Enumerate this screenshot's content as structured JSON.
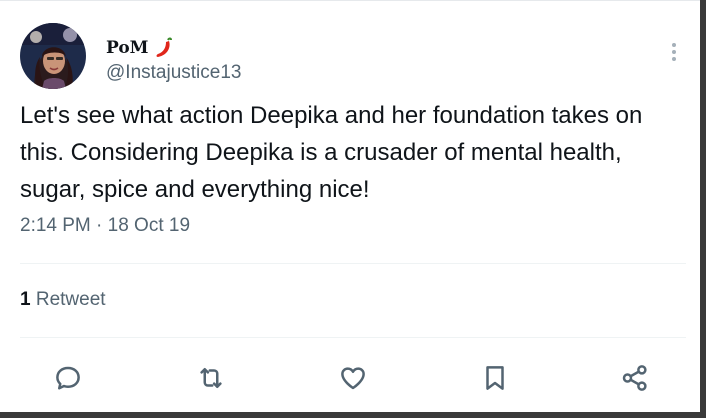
{
  "tweet": {
    "display_name": "PoM",
    "name_emoji": "chili-pepper",
    "handle": "@Instajustice13",
    "text": "Let's see what action Deepika and her foundation takes on this. Considering Deepika is a crusader of mental health, sugar, spice and everything nice!",
    "timestamp": "2:14 PM · 18 Oct 19"
  },
  "stats": {
    "retweet_count": "1",
    "retweet_label": "Retweet"
  },
  "actions": [
    {
      "icon": "reply-icon"
    },
    {
      "icon": "retweet-icon"
    },
    {
      "icon": "like-icon"
    },
    {
      "icon": "bookmark-icon"
    },
    {
      "icon": "share-icon"
    }
  ],
  "colors": {
    "text_primary": "#0f1419",
    "text_secondary": "#536471",
    "icon": "#536471",
    "chili": "#e0261b"
  }
}
